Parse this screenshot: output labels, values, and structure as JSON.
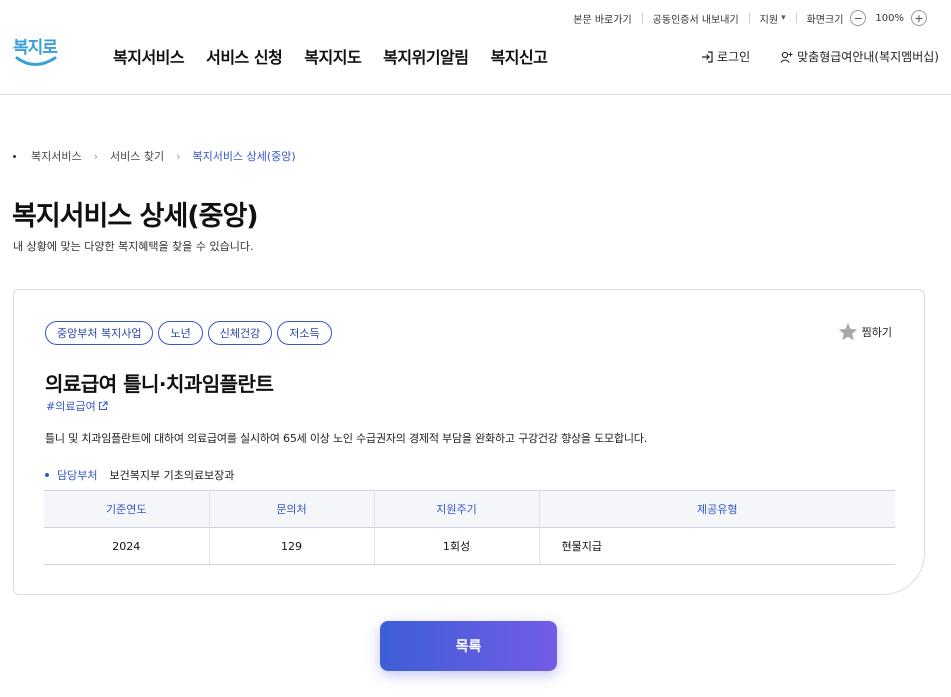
{
  "utility": {
    "skip_link": "본문 바로가기",
    "cert_export": "공동인증서 내보내기",
    "support": "지원",
    "zoom_label": "화면크기",
    "zoom_value": "100%",
    "zoom_minus": "−",
    "zoom_plus": "+"
  },
  "header": {
    "logo_text": "복지로",
    "nav": [
      "복지서비스",
      "서비스 신청",
      "복지지도",
      "복지위기알림",
      "복지신고"
    ],
    "login": "로그인",
    "membership": "맞춤형급여안내(복지멤버십)"
  },
  "breadcrumb": [
    "복지서비스",
    "서비스 찾기",
    "복지서비스 상세(중앙)"
  ],
  "page": {
    "title": "복지서비스 상세(중앙)",
    "subtitle": "내 상황에 맞는 다양한 복지혜택을 찾을 수 있습니다."
  },
  "service": {
    "tags": [
      "중앙부처 복지사업",
      "노년",
      "신체건강",
      "저소득"
    ],
    "favorite": "찜하기",
    "title": "의료급여 틀니·치과임플란트",
    "hashtag": "#의료급여",
    "description": "틀니 및 치과임플란트에 대하여 의료급여를 실시하여 65세 이상 노인 수급권자의 경제적 부담을 완화하고 구강건강 향상을 도모합니다.",
    "dept_label": "담당부처",
    "dept_value": "보건복지부 기초의료보장과",
    "table": {
      "headers": [
        "기준연도",
        "문의처",
        "지원주기",
        "제공유형"
      ],
      "row": [
        "2024",
        "129",
        "1회성",
        "현물지급"
      ]
    }
  },
  "actions": {
    "list_button": "목록"
  },
  "colors": {
    "accent": "#3557c8",
    "button_gradient_start": "#3e5fd6",
    "button_gradient_end": "#735ce6"
  }
}
